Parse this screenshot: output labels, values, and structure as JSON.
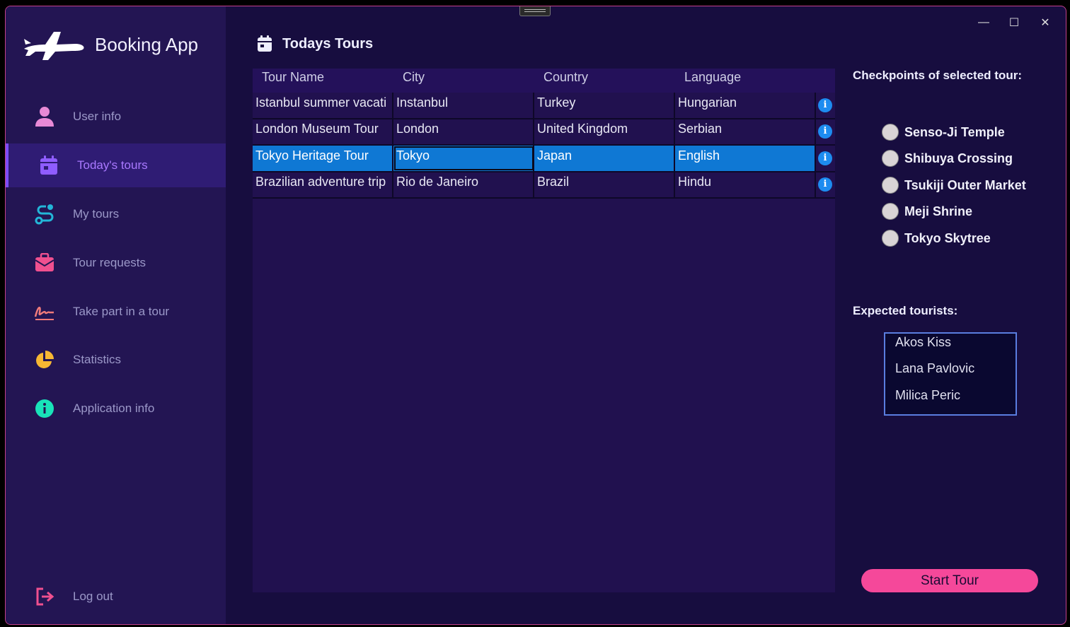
{
  "app": {
    "title": "Booking App"
  },
  "colors": {
    "accent": "#7c4dff",
    "selected_row": "#0f78d4",
    "start_button": "#f5489a",
    "sidebar": "#231553",
    "background": "#170d3f"
  },
  "sidebar": {
    "items": [
      {
        "label": "User info",
        "icon": "user-icon",
        "color": "#e889d6"
      },
      {
        "label": "Today's tours",
        "icon": "calendar-icon",
        "color": "#8f5dff",
        "active": true
      },
      {
        "label": "My tours",
        "icon": "route-icon",
        "color": "#23b6d8"
      },
      {
        "label": "Tour requests",
        "icon": "mail-icon",
        "color": "#f0508f"
      },
      {
        "label": "Take part in a tour",
        "icon": "signature-icon",
        "color": "#f07a7a"
      },
      {
        "label": "Statistics",
        "icon": "pie-chart-icon",
        "color": "#f7b733"
      },
      {
        "label": "Application info",
        "icon": "info-icon",
        "color": "#19e3b9"
      }
    ],
    "logout": {
      "label": "Log out",
      "icon": "logout-icon",
      "color": "#f0508f"
    }
  },
  "header": {
    "title": "Todays Tours",
    "icon": "calendar-icon"
  },
  "table": {
    "columns": [
      "Tour Name",
      "City",
      "Country",
      "Language"
    ],
    "rows": [
      {
        "cells": [
          "Istanbul summer vacati",
          "Instanbul",
          "Turkey",
          "Hungarian"
        ]
      },
      {
        "cells": [
          "London Museum Tour",
          "London",
          "United Kingdom",
          "Serbian"
        ]
      },
      {
        "cells": [
          "Tokyo Heritage Tour",
          "Tokyo",
          "Japan",
          "English"
        ],
        "selected": true
      },
      {
        "cells": [
          "Brazilian adventure trip",
          "Rio de Janeiro",
          "Brazil",
          "Hindu"
        ]
      }
    ],
    "info_glyph": "i"
  },
  "checkpoints": {
    "title": "Checkpoints of selected tour:",
    "items": [
      "Senso-Ji Temple",
      "Shibuya Crossing",
      "Tsukiji Outer Market",
      "Meji Shrine",
      "Tokyo Skytree"
    ]
  },
  "tourists": {
    "title": "Expected tourists:",
    "items": [
      "Akos Kiss",
      "Lana Pavlovic",
      "Milica Peric"
    ]
  },
  "actions": {
    "start_tour": "Start Tour"
  },
  "window_controls": {
    "minimize": "—",
    "maximize": "☐",
    "close": "✕"
  }
}
